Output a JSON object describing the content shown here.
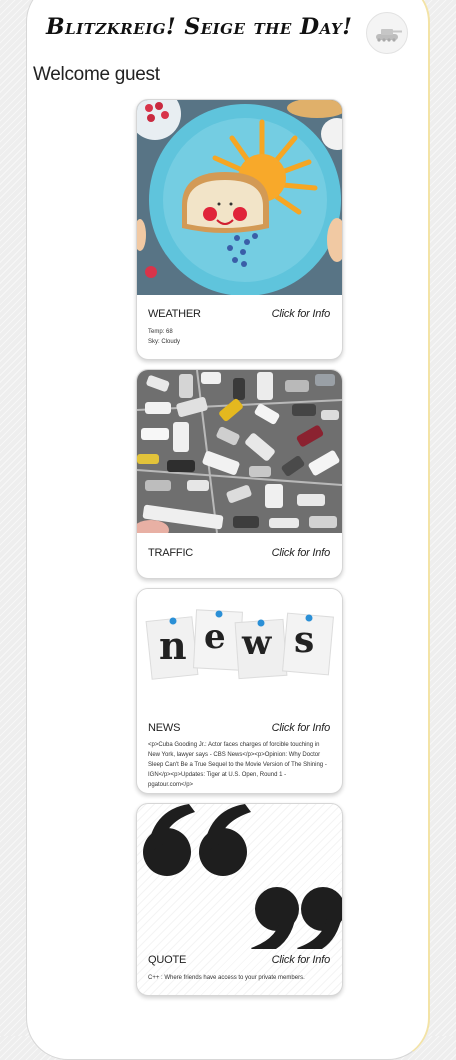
{
  "header": {
    "title": "Blitzkreig! Seige the Day!",
    "logo_icon": "tank-icon"
  },
  "welcome": "Welcome guest",
  "cards": {
    "weather": {
      "label": "WEATHER",
      "link": "Click for Info",
      "lines": [
        "Temp: 68",
        "Sky: Cloudy"
      ]
    },
    "traffic": {
      "label": "TRAFFIC",
      "link": "Click for Info"
    },
    "news": {
      "label": "NEWS",
      "link": "Click for Info",
      "body": "<p>Cuba Gooding Jr.: Actor faces charges of forcible touching in New York, lawyer says - CBS News</p><p>Opinion: Why Doctor Sleep Can't Be a True Sequel to the Movie Version of The Shining - IGN</p><p>Updates: Tiger at U.S. Open, Round 1 - pgatour.com</p>",
      "letters": [
        "n",
        "e",
        "w",
        "s"
      ]
    },
    "quote": {
      "label": "QUOTE",
      "link": "Click for Info",
      "body": "C++ : Where friends have access to your private members."
    }
  },
  "colors": {
    "plate": "#5fc4dc",
    "table": "#5f7b8d",
    "road": "#6f6f6f",
    "note_pin": "#2a8fd6"
  }
}
